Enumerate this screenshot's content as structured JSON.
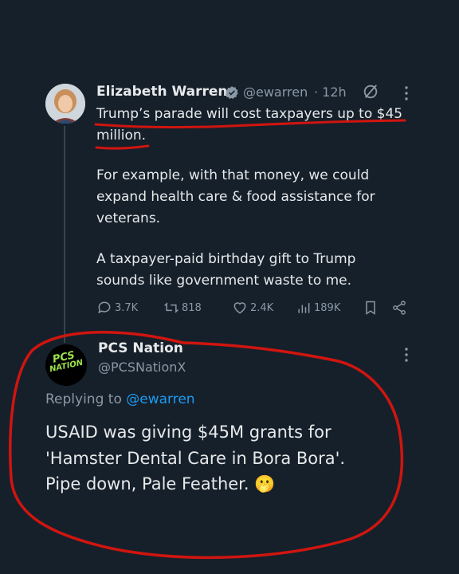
{
  "tweet": {
    "author_name": "Elizabeth Warren",
    "handle": "@ewarren",
    "time": "· 12h",
    "lines": [
      "Trump’s parade will cost taxpayers up to $45",
      "million."
    ],
    "para2": [
      "For example, with that money, we could",
      "expand health care & food assistance for",
      "veterans."
    ],
    "para3": [
      "A taxpayer-paid birthday gift to Trump",
      "sounds like government waste to me."
    ],
    "stats": {
      "replies": "3.7K",
      "reposts": "818",
      "likes": "2.4K",
      "views": "189K"
    }
  },
  "reply": {
    "author_name": "PCS Nation",
    "handle": "@PCSNationX",
    "avatar_text": [
      "PCS",
      "NATION"
    ],
    "replying_prefix": "Replying to",
    "replying_handle": "@ewarren",
    "lines": [
      "USAID was giving $45M grants for",
      "'Hamster Dental Care in Bora Bora'.",
      "Pipe down, Pale Feather. 🫢"
    ]
  },
  "colors": {
    "background": "#15202b",
    "accent": "#1d9bf0",
    "verified": "#8b98a5",
    "annotation_red": "#d0150f",
    "avatar_green": "#9be34a"
  },
  "icons": [
    "verified-icon",
    "grok-icon",
    "more-icon",
    "reply-icon",
    "repost-icon",
    "like-icon",
    "views-icon",
    "bookmark-icon",
    "share-icon",
    "face-emoji"
  ]
}
